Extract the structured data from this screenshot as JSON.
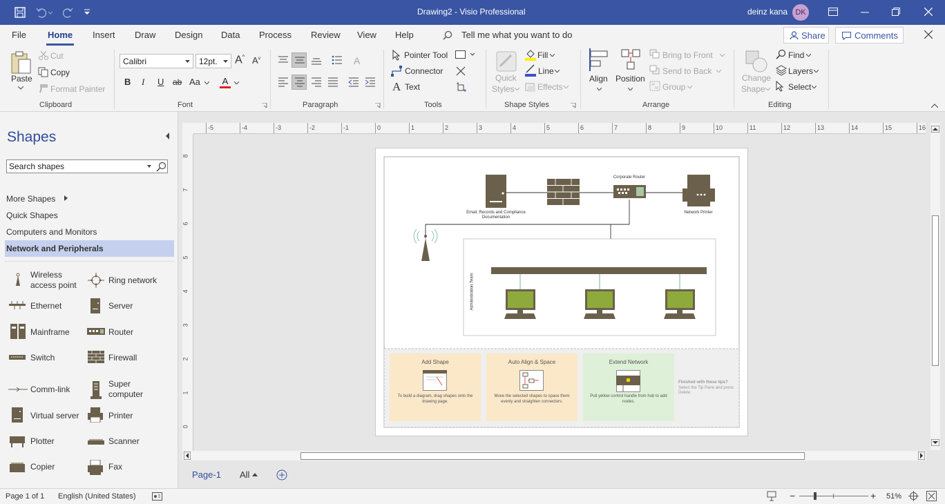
{
  "titlebar": {
    "title": "Drawing2  -  Visio Professional",
    "user": "deinz kana",
    "initials": "DK"
  },
  "menu": [
    "File",
    "Home",
    "Insert",
    "Draw",
    "Design",
    "Data",
    "Process",
    "Review",
    "View",
    "Help"
  ],
  "tell_me": "Tell me what you want to do",
  "share": "Share",
  "comments": "Comments",
  "ribbon": {
    "paste": "Paste",
    "cut": "Cut",
    "copy": "Copy",
    "format_painter": "Format Painter",
    "font": "Calibri",
    "size": "12pt.",
    "bold": "B",
    "italic": "I",
    "underline": "U",
    "strike": "ab",
    "aa": "Aa",
    "pointer": "Pointer Tool",
    "connector": "Connector",
    "text": "Text",
    "quick1": "Quick",
    "quick2": "Styles",
    "fill": "Fill",
    "line": "Line",
    "effects": "Effects",
    "align": "Align",
    "position": "Position",
    "bring_front": "Bring to Front",
    "send_back": "Send to Back",
    "group": "Group",
    "change1": "Change",
    "change2": "Shape",
    "find": "Find",
    "layers": "Layers",
    "select": "Select",
    "groups": [
      "Clipboard",
      "Font",
      "Paragraph",
      "Tools",
      "Shape Styles",
      "Arrange",
      "Editing"
    ]
  },
  "shapes_panel": {
    "title": "Shapes",
    "search_placeholder": "Search shapes",
    "nav": [
      "More Shapes",
      "Quick Shapes",
      "Computers and Monitors",
      "Network and Peripherals"
    ],
    "stencils": [
      {
        "label": "Wireless access point",
        "icon": "wireless-icon"
      },
      {
        "label": "Ring network",
        "icon": "ring-icon"
      },
      {
        "label": "Ethernet",
        "icon": "ethernet-icon"
      },
      {
        "label": "Server",
        "icon": "server-icon"
      },
      {
        "label": "Mainframe",
        "icon": "mainframe-icon"
      },
      {
        "label": "Router",
        "icon": "router-icon"
      },
      {
        "label": "Switch",
        "icon": "switch-icon"
      },
      {
        "label": "Firewall",
        "icon": "firewall-icon"
      },
      {
        "label": "Comm-link",
        "icon": "commlink-icon"
      },
      {
        "label": "Super computer",
        "icon": "supercomputer-icon"
      },
      {
        "label": "Virtual server",
        "icon": "virtual-server-icon"
      },
      {
        "label": "Printer",
        "icon": "printer-icon"
      },
      {
        "label": "Plotter",
        "icon": "plotter-icon"
      },
      {
        "label": "Scanner",
        "icon": "scanner-icon"
      },
      {
        "label": "Copier",
        "icon": "copier-icon"
      },
      {
        "label": "Fax",
        "icon": "fax-icon"
      }
    ]
  },
  "ruler": {
    "h": [
      "-5",
      "-4",
      "-3",
      "-2",
      "-1",
      "0",
      "1",
      "2",
      "3",
      "4",
      "5",
      "6",
      "7",
      "8",
      "9",
      "10",
      "11",
      "12",
      "13",
      "14",
      "15",
      "16"
    ],
    "v": [
      "8",
      "7",
      "6",
      "5",
      "4",
      "3",
      "2",
      "1",
      "0"
    ]
  },
  "diagram": {
    "router_label": "Corporate Router",
    "server_label": "Email, Records and Compliance Documentation",
    "printer_label": "Network Printer",
    "team_label": "Administration Team",
    "tips": [
      {
        "title": "Add Shape",
        "desc": "To build a diagram, drag shapes onto the drawing page."
      },
      {
        "title": "Auto Align & Space",
        "desc": "Move the selected shapes to space them evenly and straighten connectors."
      },
      {
        "title": "Extend Network",
        "desc": "Pull yellow control handle from hub to add nodes."
      }
    ],
    "finished_title": "Finished with these tips?",
    "finished_desc": "Select the Tip Pane and press Delete"
  },
  "tabs": {
    "page": "Page-1",
    "all": "All"
  },
  "status": {
    "page": "Page 1 of 1",
    "lang": "English (United States)",
    "zoom": "51%"
  },
  "colors": {
    "accent": "#3955a3",
    "shape": "#6b604b",
    "screen": "#8faa3c"
  }
}
